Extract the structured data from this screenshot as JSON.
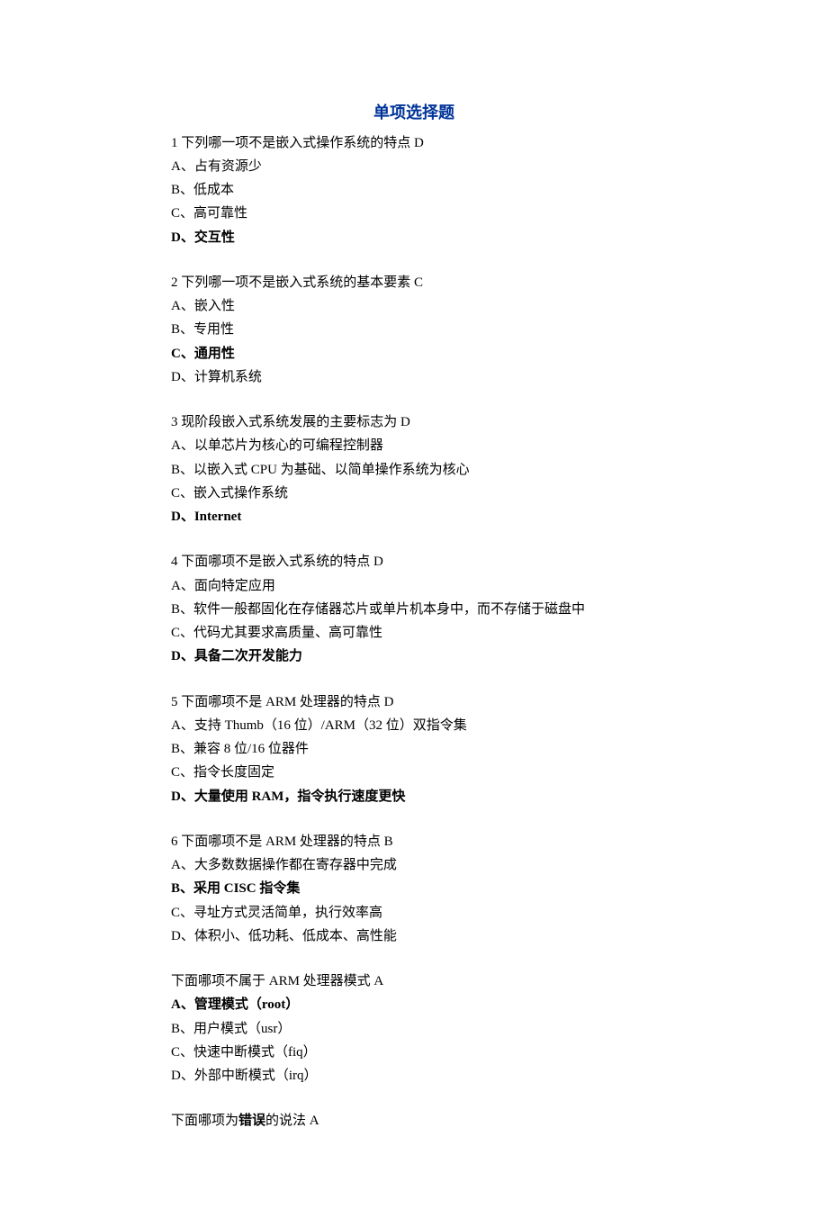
{
  "title": "单项选择题",
  "questions": [
    {
      "prompt": "1 下列哪一项不是嵌入式操作系统的特点    D",
      "options": [
        {
          "text": "A、占有资源少",
          "bold": false
        },
        {
          "text": "B、低成本",
          "bold": false
        },
        {
          "text": "C、高可靠性",
          "bold": false
        },
        {
          "text": "D、交互性",
          "bold": true
        }
      ]
    },
    {
      "prompt": "2 下列哪一项不是嵌入式系统的基本要素   C",
      "options": [
        {
          "text": "A、嵌入性",
          "bold": false
        },
        {
          "text": "B、专用性",
          "bold": false
        },
        {
          "text": "C、通用性",
          "bold": true
        },
        {
          "text": "D、计算机系统",
          "bold": false
        }
      ]
    },
    {
      "prompt": "3 现阶段嵌入式系统发展的主要标志为     D",
      "options": [
        {
          "text": "A、以单芯片为核心的可编程控制器",
          "bold": false
        },
        {
          "text": "B、以嵌入式 CPU 为基础、以简单操作系统为核心",
          "bold": false
        },
        {
          "text": "C、嵌入式操作系统",
          "bold": false
        },
        {
          "text": "D、Internet",
          "bold": true
        }
      ]
    },
    {
      "prompt": "4 下面哪项不是嵌入式系统的特点   D",
      "options": [
        {
          "text": "A、面向特定应用",
          "bold": false
        },
        {
          "text": "B、软件一般都固化在存储器芯片或单片机本身中，而不存储于磁盘中",
          "bold": false
        },
        {
          "text": "C、代码尤其要求高质量、高可靠性",
          "bold": false
        },
        {
          "text": "D、具备二次开发能力",
          "bold": true
        }
      ]
    },
    {
      "prompt": "5 下面哪项不是 ARM 处理器的特点   D",
      "options": [
        {
          "text": "A、支持 Thumb（16 位）/ARM（32 位）双指令集",
          "bold": false
        },
        {
          "text": "B、兼容 8 位/16 位器件",
          "bold": false
        },
        {
          "text": "C、指令长度固定",
          "bold": false
        },
        {
          "text": "D、大量使用 RAM，指令执行速度更快",
          "bold": true
        }
      ]
    },
    {
      "prompt": "6 下面哪项不是 ARM 处理器的特点   B",
      "options": [
        {
          "text": "A、大多数数据操作都在寄存器中完成",
          "bold": false
        },
        {
          "text": "B、采用 CISC 指令集",
          "bold": true
        },
        {
          "text": "C、寻址方式灵活简单，执行效率高",
          "bold": false
        },
        {
          "text": "D、体积小、低功耗、低成本、高性能",
          "bold": false
        }
      ]
    },
    {
      "prompt": "下面哪项不属于 ARM 处理器模式       A",
      "options": [
        {
          "text": "A、管理模式（root）",
          "bold": true
        },
        {
          "text": "B、用户模式（usr）",
          "bold": false
        },
        {
          "text": "C、快速中断模式（fiq）",
          "bold": false
        },
        {
          "text": "D、外部中断模式（irq）",
          "bold": false
        }
      ]
    }
  ],
  "trailing": {
    "pre": "下面哪项为",
    "bold": "错误",
    "post": "的说法   A"
  }
}
